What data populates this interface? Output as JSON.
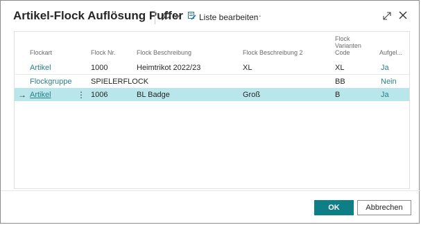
{
  "dialog": {
    "title": "Artikel-Flock Auflösung Puffer",
    "toolbar": {
      "edit_list_label": "Liste bearbeiten",
      "more_label": "···"
    },
    "buttons": {
      "ok": "OK",
      "cancel": "Abbrechen"
    },
    "accent_color": "#0e7e87",
    "selected_row_color": "#b8e6ea"
  },
  "table": {
    "columns": {
      "flockart": "Flockart",
      "flock_nr": "Flock Nr.",
      "flock_beschreibung": "Flock Beschreibung",
      "flock_beschreibung2": "Flock Beschreibung 2",
      "flock_varianten_code_1": "Flock",
      "flock_varianten_code_2": "Varianten",
      "flock_varianten_code_3": "Code",
      "aufgeloest": "Aufgel..."
    },
    "rows": [
      {
        "flockart": "Artikel",
        "flock_nr": "1000",
        "beschreibung": "Heimtrikot 2022/23",
        "beschreibung2": "XL",
        "varianten_code": "XL",
        "aufgeloest": "Ja"
      },
      {
        "flockart": "Flockgruppe",
        "flock_nr": "SPIELERFLOCK",
        "beschreibung": "",
        "beschreibung2": "",
        "varianten_code": "BB",
        "aufgeloest": "Nein"
      },
      {
        "flockart": "Artikel",
        "flock_nr": "1006",
        "beschreibung": "BL Badge",
        "beschreibung2": "Groß",
        "varianten_code": "B",
        "aufgeloest": "Ja",
        "selected": true
      }
    ]
  }
}
